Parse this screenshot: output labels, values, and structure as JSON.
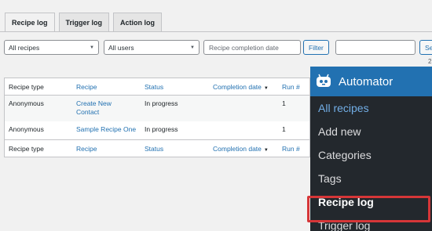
{
  "tabs": [
    {
      "label": "Recipe log"
    },
    {
      "label": "Trigger log"
    },
    {
      "label": "Action log"
    }
  ],
  "filters": {
    "recipes": "All recipes",
    "users": "All users",
    "date_placeholder": "Recipe completion date",
    "filter_button": "Filter",
    "search_button": "Se"
  },
  "pager": {
    "count_fragment": "2"
  },
  "table": {
    "columns": [
      "Recipe type",
      "Recipe",
      "Status",
      "Completion date",
      "Run #"
    ],
    "rows": [
      {
        "type": "Anonymous",
        "recipe": "Create New Contact",
        "status": "In progress",
        "date": "",
        "run": "1"
      },
      {
        "type": "Anonymous",
        "recipe": "Sample Recipe One",
        "status": "In progress",
        "date": "",
        "run": "1"
      }
    ]
  },
  "menu": {
    "title": "Automator",
    "items": [
      {
        "label": "All recipes"
      },
      {
        "label": "Add new"
      },
      {
        "label": "Categories"
      },
      {
        "label": "Tags"
      },
      {
        "label": "Recipe log"
      },
      {
        "label": "Trigger log"
      }
    ]
  },
  "colors": {
    "accent": "#2271b1",
    "menu_bg": "#23282d",
    "highlight": "#d63638"
  }
}
